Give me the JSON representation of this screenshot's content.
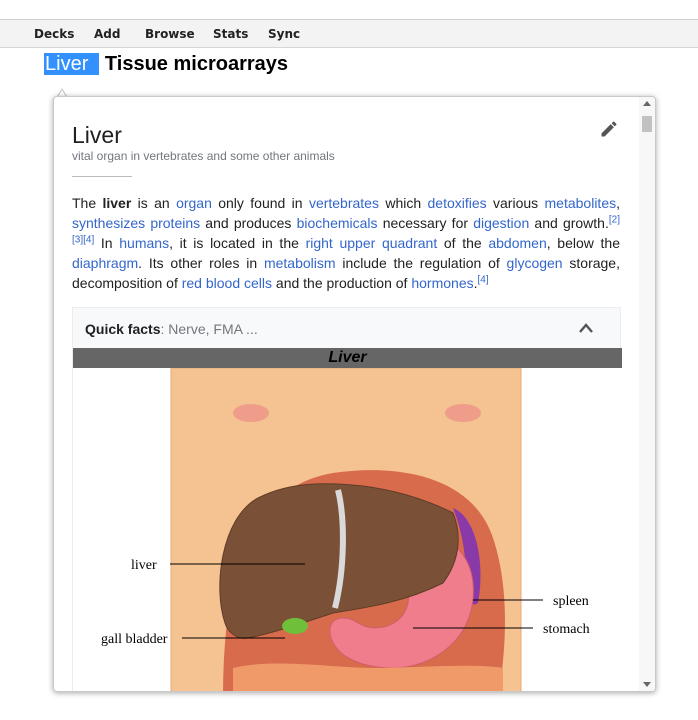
{
  "menu": [
    "Decks",
    "Add",
    "Browse",
    "Stats",
    "Sync"
  ],
  "heading": {
    "highlight": "Liver",
    "rest": "Tissue microarrays"
  },
  "popup": {
    "title": "Liver",
    "description": "vital organ in vertebrates and some other animals",
    "paragraph": {
      "t1": "The ",
      "bold": "liver",
      "t2": " is an ",
      "l_organ": "organ",
      "t3": " only found in ",
      "l_vertebrates": "vertebrates",
      "t4": " which ",
      "l_detoxifies": "detoxifies",
      "t5": " various ",
      "l_metabolites": "metabolites",
      "t6": ", ",
      "l_synthesizes": "synthesizes proteins",
      "t7": " and produces ",
      "l_biochemicals": "biochemicals",
      "t8": " necessary for ",
      "l_digestion": "digestion",
      "t9": " and growth.",
      "ref2": "[2]",
      "ref3": "[3]",
      "ref4a": "[4]",
      "t10": " In ",
      "l_humans": "humans",
      "t11": ", it is located in the ",
      "l_ruq": "right upper quadrant",
      "t12": " of the ",
      "l_abdomen": "abdomen",
      "t13": ", below the ",
      "l_diaphragm": "diaphragm",
      "t14": ". Its other roles in ",
      "l_metabolism": "metabolism",
      "t15": " include the regulation of ",
      "l_glycogen": "glycogen",
      "t16": " storage, decomposition of ",
      "l_rbc": "red blood cells",
      "t17": " and the production of ",
      "l_hormones": "hormones",
      "t18": ".",
      "ref4b": "[4]"
    },
    "quick_facts": {
      "label": "Quick facts",
      "summary": ": Nerve, FMA ...",
      "banner": "Liver",
      "diagram_labels": {
        "liver": "liver",
        "gall_bladder": "gall bladder",
        "spleen": "spleen",
        "stomach": "stomach"
      }
    }
  },
  "colors": {
    "link": "#3366cc",
    "highlight": "#3390ff",
    "banner": "#666666"
  }
}
